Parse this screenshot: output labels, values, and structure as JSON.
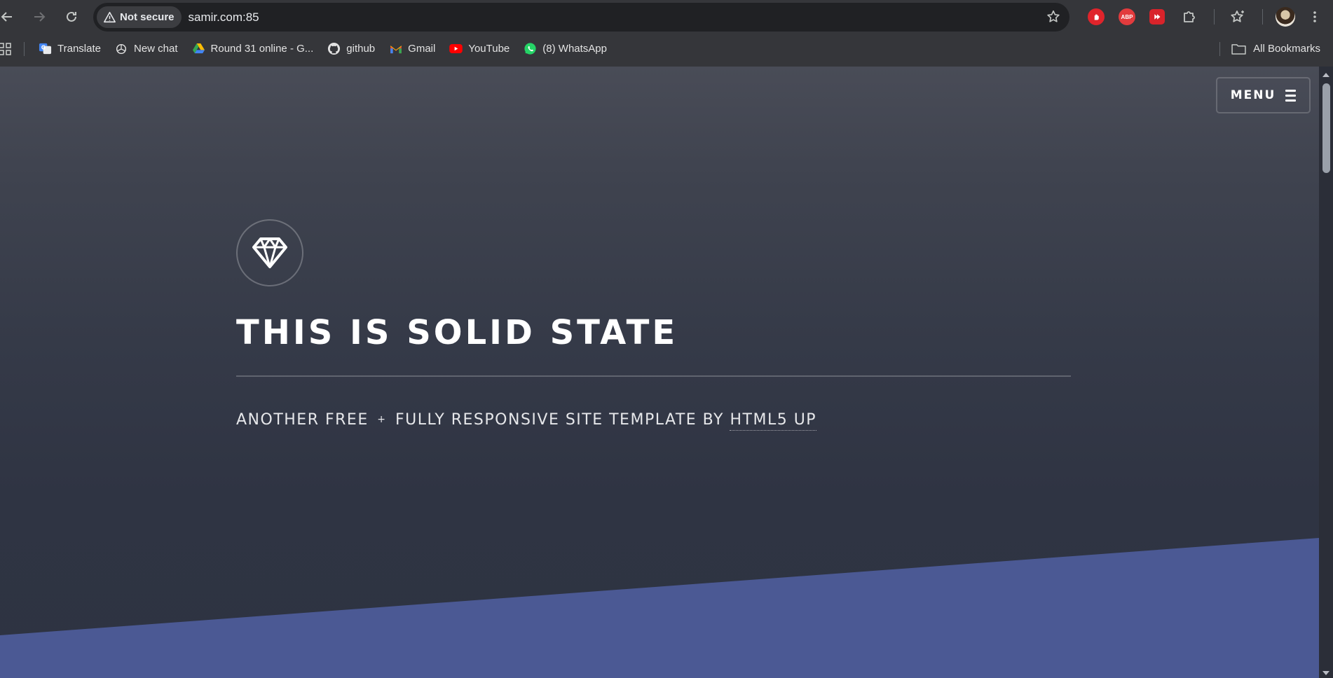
{
  "browser": {
    "security_label": "Not secure",
    "url": "samir.com:85",
    "extensions": [
      "adblock-hand-icon",
      "abp-icon",
      "video-ext-icon",
      "puzzle-icon"
    ],
    "abp_text": "ABP"
  },
  "bookmarks": {
    "items": [
      {
        "label": "Translate",
        "icon": "translate-icon"
      },
      {
        "label": "New chat",
        "icon": "openai-icon"
      },
      {
        "label": "Round 31 online - G...",
        "icon": "drive-icon"
      },
      {
        "label": "github",
        "icon": "github-icon"
      },
      {
        "label": "Gmail",
        "icon": "gmail-icon"
      },
      {
        "label": "YouTube",
        "icon": "youtube-icon"
      },
      {
        "label": "(8) WhatsApp",
        "icon": "whatsapp-icon"
      }
    ],
    "all_bookmarks": "All Bookmarks"
  },
  "page": {
    "menu_label": "MENU",
    "title": "THIS IS SOLID STATE",
    "subtitle_part1": "ANOTHER FREE",
    "subtitle_plus": "+",
    "subtitle_part2": "FULLY RESPONSIVE SITE TEMPLATE BY",
    "subtitle_link": "HTML5 UP"
  },
  "colors": {
    "hero_bg_top": "#494c57",
    "hero_bg_bottom": "#2e3342",
    "wedge": "#4b5994"
  }
}
